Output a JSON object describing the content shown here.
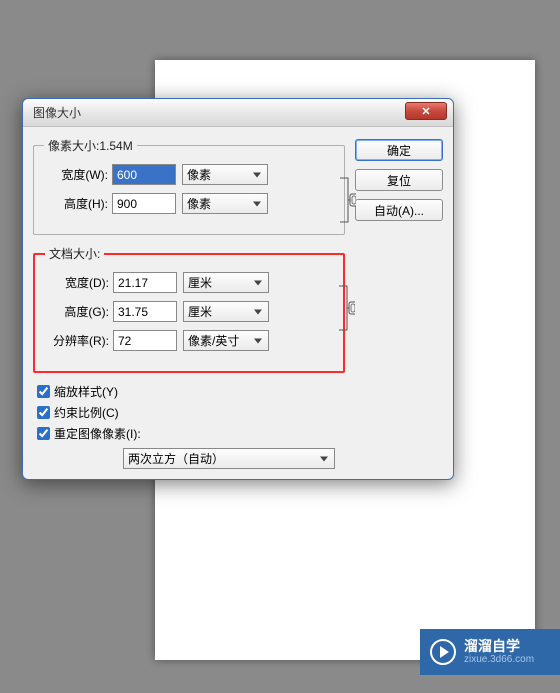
{
  "dialog": {
    "title": "图像大小",
    "close": "✕",
    "pixel_legend": "像素大小:1.54M",
    "width_w_label": "宽度(W):",
    "width_w_value": "600",
    "width_w_unit": "像素",
    "height_h_label": "高度(H):",
    "height_h_value": "900",
    "height_h_unit": "像素",
    "doc_legend": "文档大小:",
    "width_d_label": "宽度(D):",
    "width_d_value": "21.17",
    "width_d_unit": "厘米",
    "height_g_label": "高度(G):",
    "height_g_value": "31.75",
    "height_g_unit": "厘米",
    "res_r_label": "分辨率(R):",
    "res_r_value": "72",
    "res_r_unit": "像素/英寸",
    "scale_styles": "缩放样式(Y)",
    "constrain": "约束比例(C)",
    "resample": "重定图像像素(I):",
    "resample_method": "两次立方（自动）"
  },
  "buttons": {
    "ok": "确定",
    "reset": "复位",
    "auto": "自动(A)..."
  },
  "watermark": {
    "line1": "溜溜自学",
    "line2": "zixue.3d66.com"
  }
}
